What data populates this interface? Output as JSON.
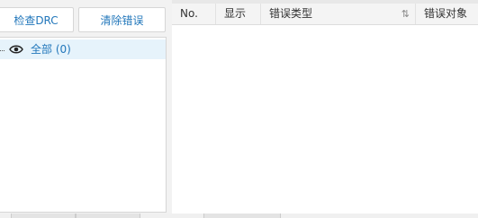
{
  "buttons": {
    "check_drc": "检查DRC",
    "clear_errors": "清除错误"
  },
  "tree": {
    "items": [
      {
        "label": "全部 (0)",
        "icon": "eye-icon"
      }
    ]
  },
  "table": {
    "columns": [
      "No.",
      "显示",
      "错误类型",
      "错误对象"
    ],
    "sort_icon": "⇅",
    "rows": []
  },
  "colors": {
    "accent": "#2277bb",
    "selected_row": "#e6f3fb"
  }
}
